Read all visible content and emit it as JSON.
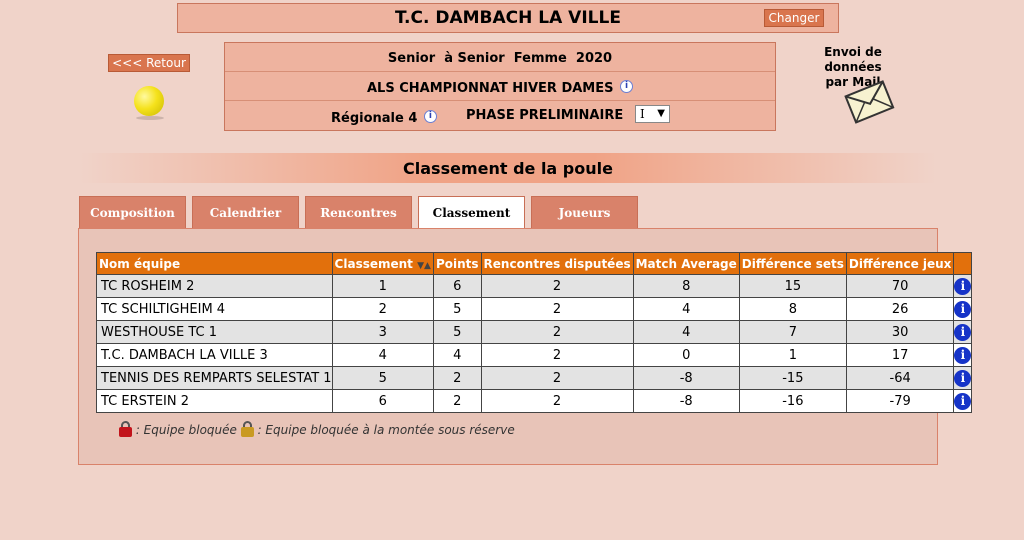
{
  "header": {
    "club_name": "T.C. DAMBACH LA VILLE",
    "change_button": "Changer",
    "back_button": "<<< Retour"
  },
  "competition": {
    "category": "Senior  à Senior  Femme  2020",
    "championship": "ALS CHAMPIONNAT HIVER DAMES",
    "division": "Régionale 4",
    "phase_label": "PHASE PRELIMINAIRE",
    "phase_value": "I"
  },
  "mail": {
    "label_line1": "Envoi de données",
    "label_line2": "par Mail"
  },
  "section_title": "Classement de la poule",
  "tabs": [
    {
      "label": "Composition",
      "active": false
    },
    {
      "label": "Calendrier",
      "active": false
    },
    {
      "label": "Rencontres",
      "active": false
    },
    {
      "label": "Classement",
      "active": true
    },
    {
      "label": "Joueurs",
      "active": false
    }
  ],
  "table": {
    "headers": [
      "Nom équipe",
      "Classement",
      "Points",
      "Rencontres disputées",
      "Match Average",
      "Différence sets",
      "Différence jeux"
    ],
    "sort_arrows": "▼▲",
    "rows": [
      [
        "TC ROSHEIM 2",
        "1",
        "6",
        "2",
        "8",
        "15",
        "70"
      ],
      [
        "TC SCHILTIGHEIM 4",
        "2",
        "5",
        "2",
        "4",
        "8",
        "26"
      ],
      [
        "WESTHOUSE TC 1",
        "3",
        "5",
        "2",
        "4",
        "7",
        "30"
      ],
      [
        "T.C. DAMBACH LA VILLE 3",
        "4",
        "4",
        "2",
        "0",
        "1",
        "17"
      ],
      [
        "TENNIS DES REMPARTS SELESTAT 1",
        "5",
        "2",
        "2",
        "-8",
        "-15",
        "-64"
      ],
      [
        "TC ERSTEIN 2",
        "6",
        "2",
        "2",
        "-8",
        "-16",
        "-79"
      ]
    ],
    "info_glyph": "i"
  },
  "legend": {
    "locked": ": Equipe bloquée",
    "locked_reserve": ": Equipe bloquée à la montée sous réserve"
  },
  "colors": {
    "background": "#f0d3c9",
    "header_orange": "#e2700c",
    "tab_inactive": "#d9826a",
    "info_blue": "#1634c8"
  }
}
